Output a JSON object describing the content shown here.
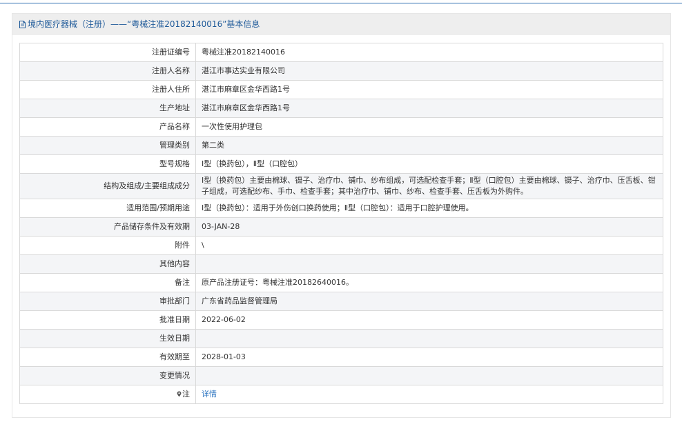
{
  "panel": {
    "title": "境内医疗器械（注册）——“粤械注准20182140016”基本信息"
  },
  "rows": [
    {
      "label": "注册证编号",
      "value": "粤械注准20182140016"
    },
    {
      "label": "注册人名称",
      "value": "湛江市事达实业有限公司"
    },
    {
      "label": "注册人住所",
      "value": "湛江市麻章区金华西路1号"
    },
    {
      "label": "生产地址",
      "value": "湛江市麻章区金华西路1号"
    },
    {
      "label": "产品名称",
      "value": "一次性使用护理包"
    },
    {
      "label": "管理类别",
      "value": "第二类"
    },
    {
      "label": "型号规格",
      "value": "Ⅰ型（换药包），Ⅱ型（口腔包）"
    },
    {
      "label": "结构及组成/主要组成成分",
      "value": "Ⅰ型（换药包）主要由棉球、镊子、治疗巾、铺巾、纱布组成，可选配检查手套；Ⅱ型（口腔包）主要由棉球、镊子、治疗巾、压舌板、钳子组成，可选配纱布、手巾、检查手套；其中治疗巾、铺巾、纱布、检查手套、压舌板为外购件。"
    },
    {
      "label": "适用范围/预期用途",
      "value": "Ⅰ型（换药包）：适用于外伤创口换药使用；Ⅱ型（口腔包）：适用于口腔护理使用。"
    },
    {
      "label": "产品储存条件及有效期",
      "value": "03-JAN-28"
    },
    {
      "label": "附件",
      "value": "\\"
    },
    {
      "label": "其他内容",
      "value": ""
    },
    {
      "label": "备注",
      "value": "原产品注册证号：粤械注准20182640016。"
    },
    {
      "label": "审批部门",
      "value": "广东省药品监督管理局"
    },
    {
      "label": "批准日期",
      "value": "2022-06-02"
    },
    {
      "label": "生效日期",
      "value": ""
    },
    {
      "label": "有效期至",
      "value": "2028-01-03"
    },
    {
      "label": "变更情况",
      "value": ""
    },
    {
      "label": "注",
      "value": "详情"
    }
  ],
  "colors": {
    "accent": "#1f5a99",
    "link": "#2a73c0",
    "header_bg": "#eeeeee",
    "alt_row_bg": "#f4f5f7",
    "border": "#d9d9d9"
  },
  "icons": {
    "title_icon": "document-icon",
    "note_icon": "location-pin-icon"
  }
}
